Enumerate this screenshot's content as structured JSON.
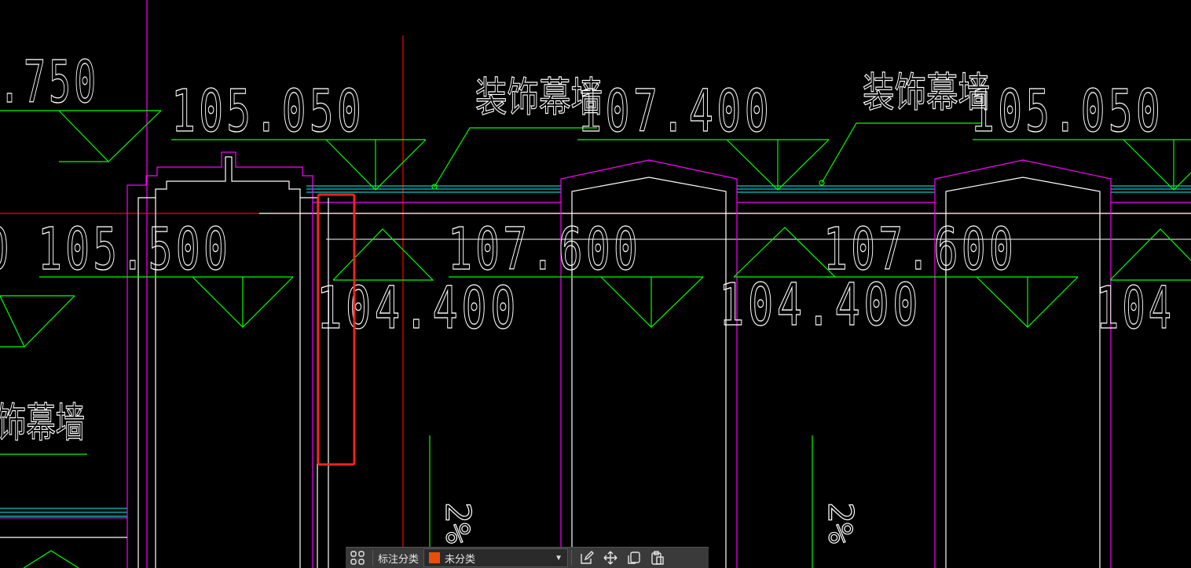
{
  "drawing": {
    "colors": {
      "background": "#000000",
      "text": "#ffffff",
      "symbol": "#00ff00",
      "wall_outline": "#ff00ff",
      "glass": "#00ffff",
      "axis": "#ff0000",
      "highlight": "#ff2020"
    },
    "elevations_top": [
      ".750",
      "105.050",
      "107.400",
      "105.050"
    ],
    "elevations_mid": [
      "0",
      "105.500",
      "107.600",
      "107.600"
    ],
    "elevations_low": [
      "104.400",
      "104.400",
      "104"
    ],
    "curtain_wall_labels": [
      "装饰幕墙",
      "装饰幕墙",
      "饰幕墙"
    ],
    "slope_labels": [
      "2%",
      "2%"
    ],
    "highlight_box_note": "selected element"
  },
  "toolbar": {
    "grid_icon": "grid-icon",
    "category_label": "标注分类",
    "category_value": "未分类",
    "category_color": "#e8500a",
    "edit_icon": "edit-icon",
    "move_icon": "move-icon",
    "copy_icon": "copy-icon",
    "paste_icon": "paste-icon"
  }
}
